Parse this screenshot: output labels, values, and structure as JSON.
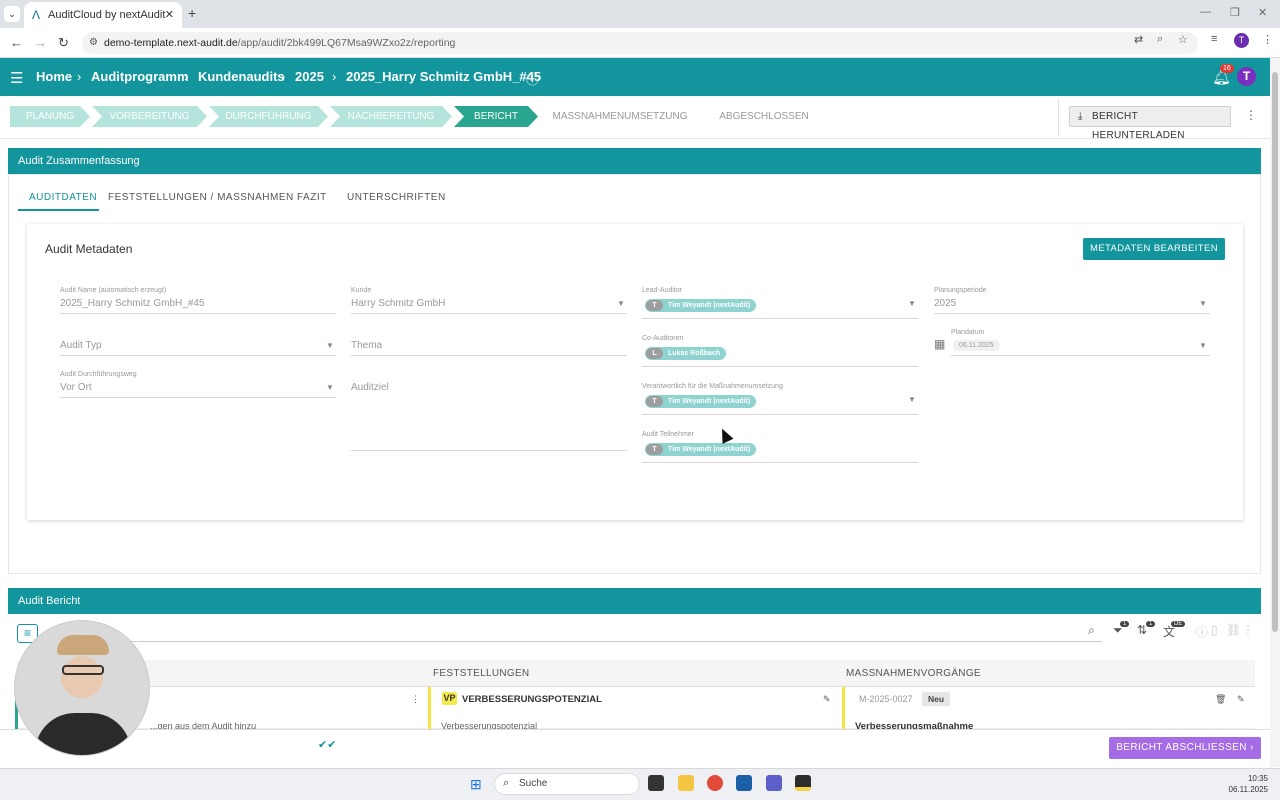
{
  "browser": {
    "tab_title": "AuditCloud by nextAudit",
    "url_host": "demo-template.next-audit.de",
    "url_path": "/app/audit/2bk499LQ67Msa9WZxo2z/reporting",
    "profile_initial": "T"
  },
  "header": {
    "breadcrumbs": [
      "Home",
      "Auditprogramm",
      "Kundenaudits",
      "2025",
      "2025_Harry Schmitz GmbH_#45"
    ],
    "notifications_count": "16",
    "avatar_initial": "T"
  },
  "stepper": {
    "steps": [
      "PLANUNG",
      "VORBEREITUNG",
      "DURCHFÜHRUNG",
      "NACHBEREITUNG",
      "BERICHT",
      "MASSNAHMENUMSETZUNG",
      "ABGESCHLOSSEN"
    ],
    "active_index": 4,
    "download_label": "BERICHT HERUNTERLADEN"
  },
  "summary": {
    "title": "Audit Zusammenfassung",
    "tabs": [
      "AUDITDATEN",
      "FESTSTELLUNGEN / MASSNAHMEN",
      "FAZIT",
      "UNTERSCHRIFTEN"
    ],
    "active_tab": "AUDITDATEN"
  },
  "meta": {
    "title": "Audit Metadaten",
    "edit_button": "METADATEN BEARBEITEN",
    "audit_name_label": "Audit Name (automatisch erzeugt)",
    "audit_name_value": "2025_Harry Schmitz GmbH_#45",
    "audit_typ_label": "Audit Typ",
    "durchfuehrungsweg_label": "Audit Durchführungsweg",
    "durchfuehrungsweg_value": "Vor Ort",
    "kunde_label": "Kunde",
    "kunde_value": "Harry Schmitz GmbH",
    "thema_label": "Thema",
    "auditziel_label": "Auditziel",
    "lead_auditor_label": "Lead-Auditor",
    "co_auditoren_label": "Co-Auditoren",
    "verantwortlich_label": "Verantwortlich für die Maßnahmenumsetzung",
    "teilnehmer_label": "Audit Teilnehmer",
    "chip_tim": "Tim Weyandt (nextAudit)",
    "chip_tim_initial": "T",
    "chip_lukas": "Lukas Roßbach",
    "chip_lukas_initial": "L",
    "planungsperiode_label": "Planungsperiode",
    "planungsperiode_value": "2025",
    "plandatum_label": "Plandatum",
    "plandatum_value": "06.11.2025"
  },
  "bericht": {
    "title": "Audit Bericht",
    "columns": [
      "FESTSTELLUNGEN",
      "MASSNAHMENVORGÄNGE"
    ],
    "filter_badges": [
      "1",
      "1"
    ],
    "lang_badge": "DE",
    "row": {
      "left_text": "...gen aus dem Audit hinzu",
      "vp_badge": "VP",
      "finding_title": "VERBESSERUNGSPOTENZIAL",
      "finding_sub": "Verbesserungspotenzial",
      "measure_id": "M-2025-0027",
      "measure_status": "Neu",
      "measure_title": "Verbesserungsmaßnahme"
    },
    "finish_button": "BERICHT ABSCHLIESSEN"
  },
  "taskbar": {
    "search_placeholder": "Suche",
    "time": "10:35",
    "date": "06.11.2025"
  }
}
